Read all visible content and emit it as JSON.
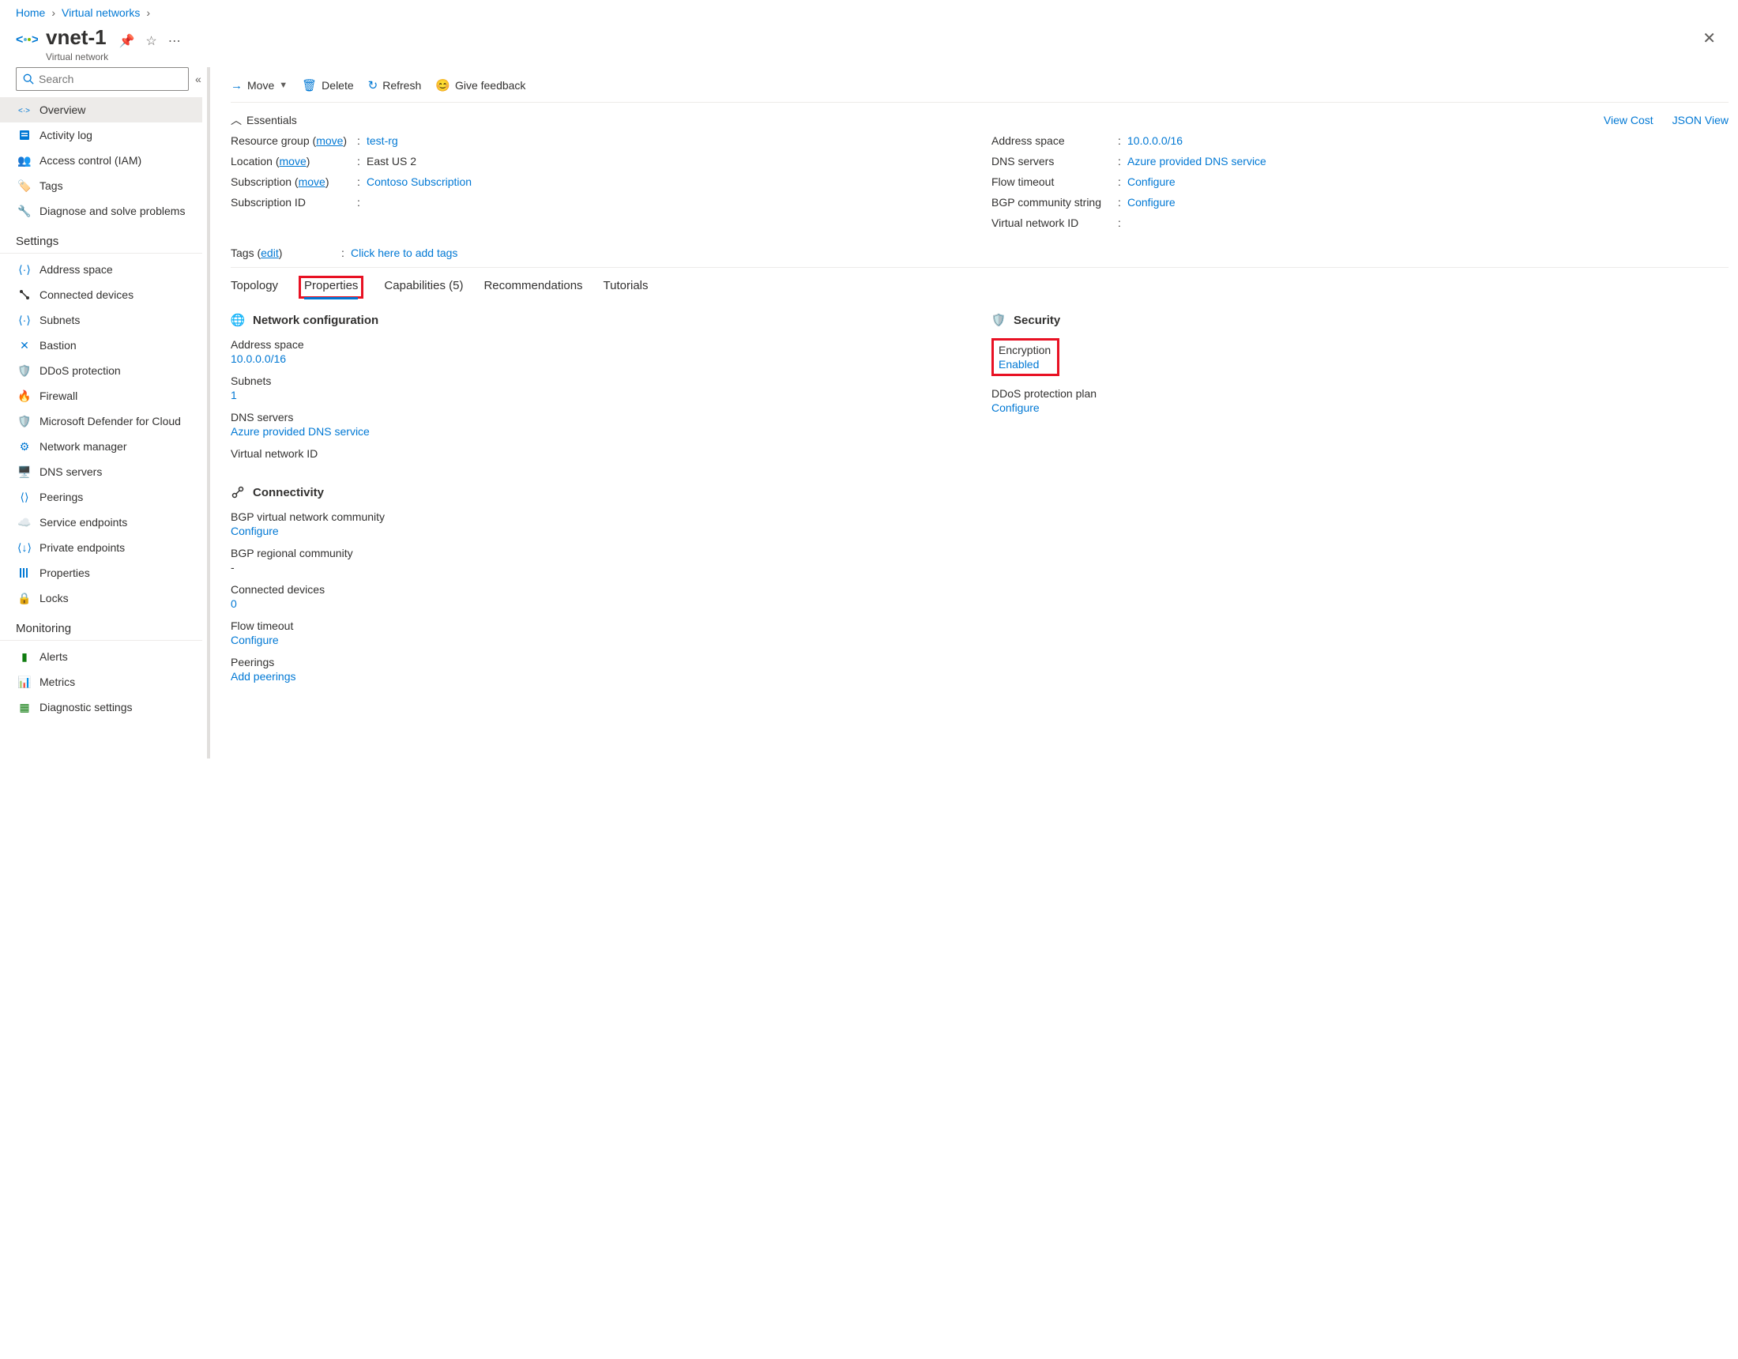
{
  "breadcrumb": {
    "items": [
      "Home",
      "Virtual networks"
    ]
  },
  "title": {
    "name": "vnet-1",
    "subtitle": "Virtual network"
  },
  "search": {
    "placeholder": "Search"
  },
  "sidebar": {
    "items": [
      {
        "label": "Overview"
      },
      {
        "label": "Activity log"
      },
      {
        "label": "Access control (IAM)"
      },
      {
        "label": "Tags"
      },
      {
        "label": "Diagnose and solve problems"
      }
    ],
    "section_settings": "Settings",
    "settings_items": [
      {
        "label": "Address space"
      },
      {
        "label": "Connected devices"
      },
      {
        "label": "Subnets"
      },
      {
        "label": "Bastion"
      },
      {
        "label": "DDoS protection"
      },
      {
        "label": "Firewall"
      },
      {
        "label": "Microsoft Defender for Cloud"
      },
      {
        "label": "Network manager"
      },
      {
        "label": "DNS servers"
      },
      {
        "label": "Peerings"
      },
      {
        "label": "Service endpoints"
      },
      {
        "label": "Private endpoints"
      },
      {
        "label": "Properties"
      },
      {
        "label": "Locks"
      }
    ],
    "section_monitoring": "Monitoring",
    "monitoring_items": [
      {
        "label": "Alerts"
      },
      {
        "label": "Metrics"
      },
      {
        "label": "Diagnostic settings"
      }
    ]
  },
  "toolbar": {
    "move": "Move",
    "delete": "Delete",
    "refresh": "Refresh",
    "feedback": "Give feedback"
  },
  "essentials": {
    "heading": "Essentials",
    "view_cost": "View Cost",
    "json_view": "JSON View",
    "left": {
      "resource_group_label": "Resource group",
      "resource_group_move": "move",
      "resource_group_value": "test-rg",
      "location_label": "Location",
      "location_move": "move",
      "location_value": "East US 2",
      "subscription_label": "Subscription",
      "subscription_move": "move",
      "subscription_value": "Contoso Subscription",
      "subscription_id_label": "Subscription ID",
      "subscription_id_value": ""
    },
    "right": {
      "address_space_label": "Address space",
      "address_space_value": "10.0.0.0/16",
      "dns_label": "DNS servers",
      "dns_value": "Azure provided DNS service",
      "flow_label": "Flow timeout",
      "flow_value": "Configure",
      "bgp_label": "BGP community string",
      "bgp_value": "Configure",
      "vnid_label": "Virtual network ID",
      "vnid_value": ""
    },
    "tags_label": "Tags",
    "tags_edit": "edit",
    "tags_value": "Click here to add tags"
  },
  "tabs": {
    "topology": "Topology",
    "properties": "Properties",
    "capabilities": "Capabilities (5)",
    "recommendations": "Recommendations",
    "tutorials": "Tutorials"
  },
  "properties": {
    "network": {
      "heading": "Network configuration",
      "address_space_k": "Address space",
      "address_space_v": "10.0.0.0/16",
      "subnets_k": "Subnets",
      "subnets_v": "1",
      "dns_k": "DNS servers",
      "dns_v": "Azure provided DNS service",
      "vnid_k": "Virtual network ID"
    },
    "security": {
      "heading": "Security",
      "encryption_k": "Encryption",
      "encryption_v": "Enabled",
      "ddos_k": "DDoS protection plan",
      "ddos_v": "Configure"
    },
    "connectivity": {
      "heading": "Connectivity",
      "bgp_vn_k": "BGP virtual network community",
      "bgp_vn_v": "Configure",
      "bgp_reg_k": "BGP regional community",
      "bgp_reg_v": "-",
      "conn_dev_k": "Connected devices",
      "conn_dev_v": "0",
      "flow_k": "Flow timeout",
      "flow_v": "Configure",
      "peer_k": "Peerings",
      "peer_v": "Add peerings"
    }
  }
}
